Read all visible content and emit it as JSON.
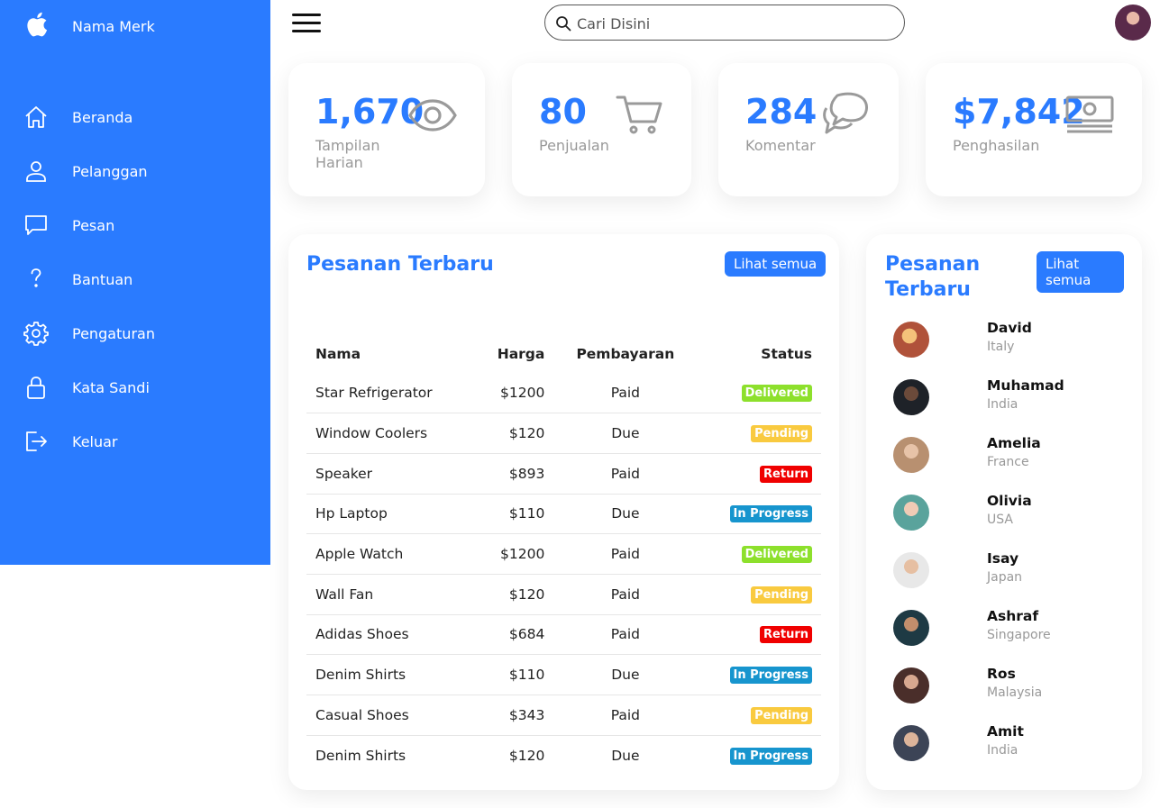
{
  "brand": {
    "name": "Nama Merk",
    "icon": "apple-icon"
  },
  "nav": [
    {
      "label": "Beranda",
      "icon": "home-icon"
    },
    {
      "label": "Pelanggan",
      "icon": "person-icon"
    },
    {
      "label": "Pesan",
      "icon": "chat-icon"
    },
    {
      "label": "Bantuan",
      "icon": "help-icon"
    },
    {
      "label": "Pengaturan",
      "icon": "gear-icon"
    },
    {
      "label": "Kata Sandi",
      "icon": "lock-icon"
    },
    {
      "label": "Keluar",
      "icon": "logout-icon"
    }
  ],
  "search": {
    "placeholder": "Cari Disini"
  },
  "cards": [
    {
      "value": "1,670",
      "label": "Tampilan Harian",
      "icon": "eye-icon"
    },
    {
      "value": "80",
      "label": "Penjualan",
      "icon": "cart-icon"
    },
    {
      "value": "284",
      "label": "Komentar",
      "icon": "chat-bubbles-icon"
    },
    {
      "value": "$7,842",
      "label": "Penghasilan",
      "icon": "cash-icon"
    }
  ],
  "orders": {
    "title": "Pesanan Terbaru",
    "button": "Lihat semua",
    "headers": {
      "name": "Nama",
      "price": "Harga",
      "payment": "Pembayaran",
      "status": "Status"
    },
    "rows": [
      {
        "name": "Star Refrigerator",
        "price": "$1200",
        "payment": "Paid",
        "status": "Delivered"
      },
      {
        "name": "Window Coolers",
        "price": "$120",
        "payment": "Due",
        "status": "Pending"
      },
      {
        "name": "Speaker",
        "price": "$893",
        "payment": "Paid",
        "status": "Return"
      },
      {
        "name": "Hp Laptop",
        "price": "$110",
        "payment": "Due",
        "status": "In Progress"
      },
      {
        "name": "Apple Watch",
        "price": "$1200",
        "payment": "Paid",
        "status": "Delivered"
      },
      {
        "name": "Wall Fan",
        "price": "$120",
        "payment": "Paid",
        "status": "Pending"
      },
      {
        "name": "Adidas Shoes",
        "price": "$684",
        "payment": "Paid",
        "status": "Return"
      },
      {
        "name": "Denim Shirts",
        "price": "$110",
        "payment": "Due",
        "status": "In Progress"
      },
      {
        "name": "Casual Shoes",
        "price": "$343",
        "payment": "Paid",
        "status": "Pending"
      },
      {
        "name": "Denim Shirts",
        "price": "$120",
        "payment": "Due",
        "status": "In Progress"
      }
    ],
    "status_colors": {
      "Delivered": "#8de02c",
      "Pending": "#f9ca3f",
      "Return": "#f00000",
      "In Progress": "#1795ce"
    }
  },
  "customers": {
    "title": "Pesanan Terbaru",
    "button": "Lihat semua",
    "items": [
      {
        "name": "David",
        "country": "Italy"
      },
      {
        "name": "Muhamad",
        "country": "India"
      },
      {
        "name": "Amelia",
        "country": "France"
      },
      {
        "name": "Olivia",
        "country": "USA"
      },
      {
        "name": "Isay",
        "country": "Japan"
      },
      {
        "name": "Ashraf",
        "country": "Singapore"
      },
      {
        "name": "Ros",
        "country": "Malaysia"
      },
      {
        "name": "Amit",
        "country": "India"
      }
    ]
  },
  "colors": {
    "accent": "#2a7bff",
    "muted": "#999999"
  }
}
